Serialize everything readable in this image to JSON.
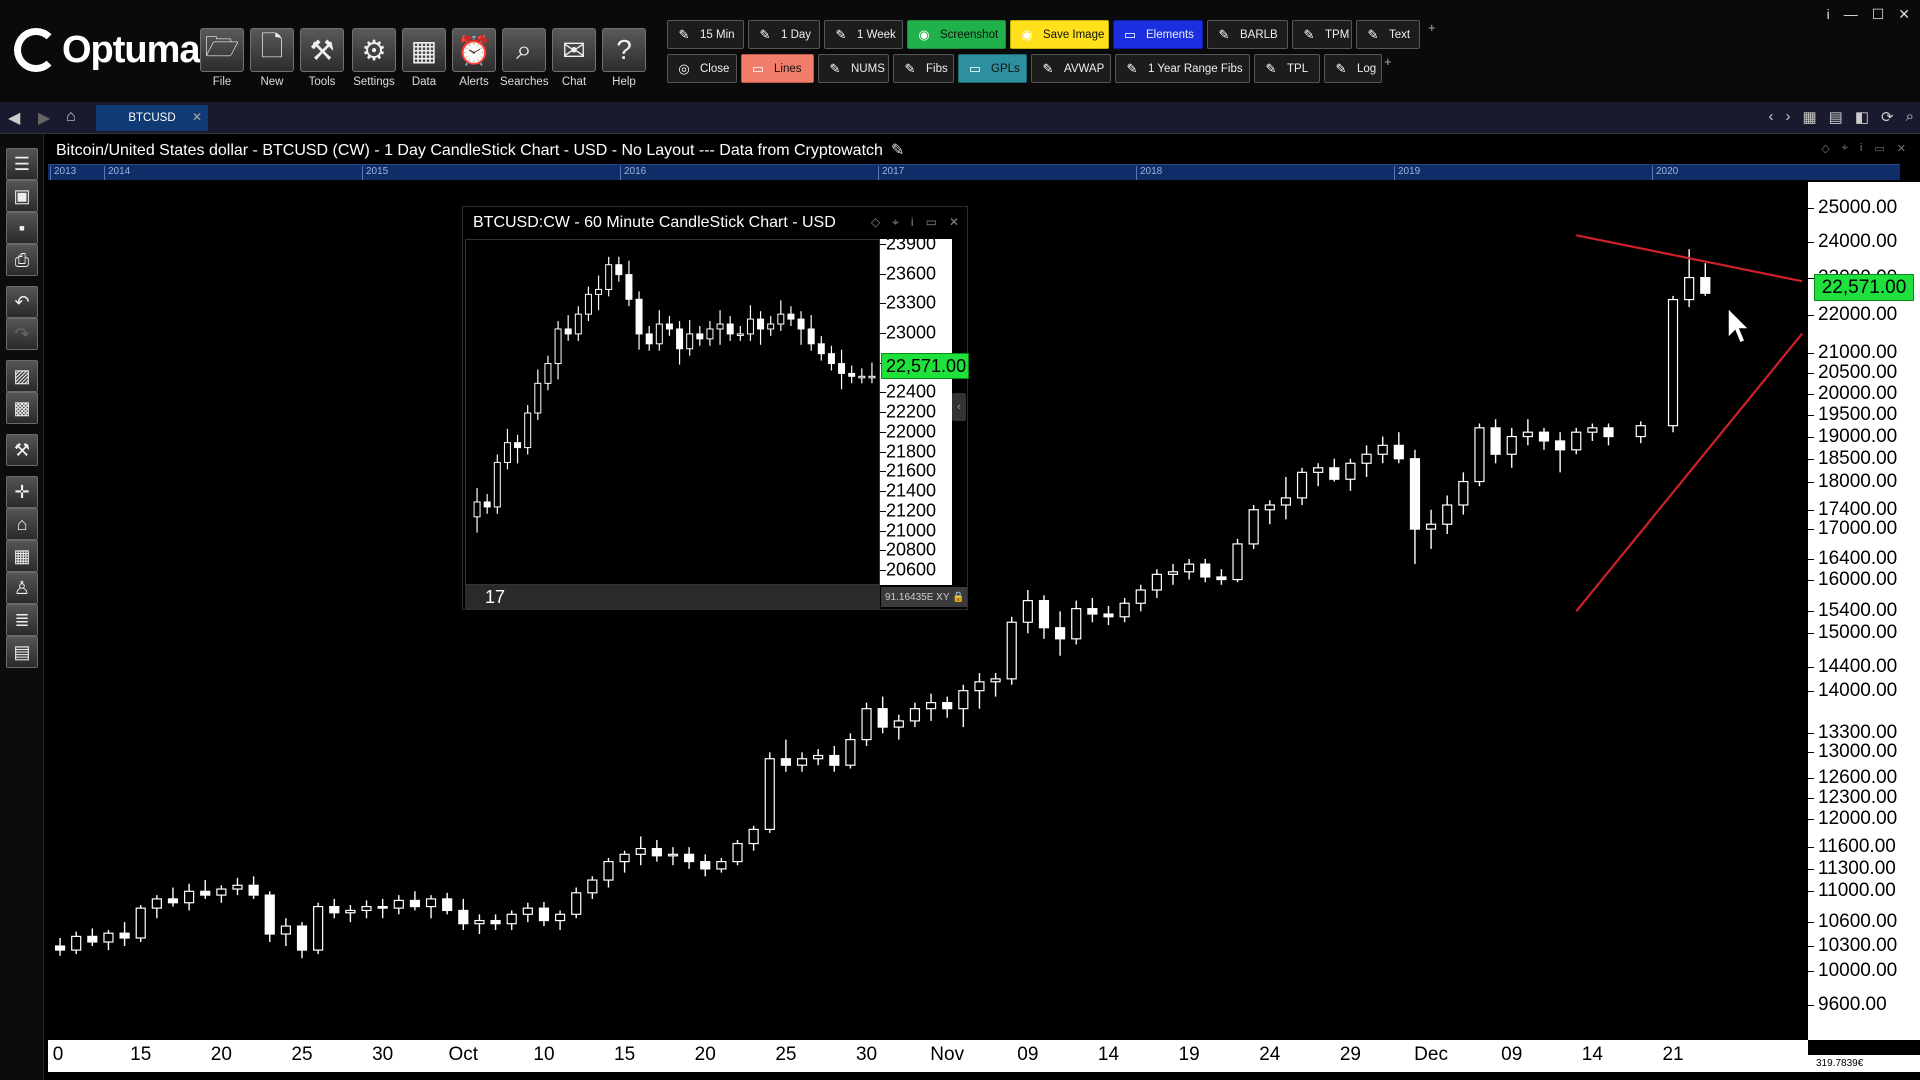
{
  "app": {
    "name": "Optuma",
    "reg": "®"
  },
  "toolbar": {
    "buttons": [
      {
        "label": "File",
        "icon": "folder-icon"
      },
      {
        "label": "New",
        "icon": "new-doc-icon"
      },
      {
        "label": "Tools",
        "icon": "tools-icon"
      },
      {
        "label": "Settings",
        "icon": "gear-icon"
      },
      {
        "label": "Data",
        "icon": "data-icon"
      },
      {
        "label": "Alerts",
        "icon": "alarm-icon"
      },
      {
        "label": "Searches",
        "icon": "search-icon"
      },
      {
        "label": "Chat",
        "icon": "chat-icon"
      },
      {
        "label": "Help",
        "icon": "help-icon"
      }
    ],
    "row1": [
      {
        "label": "15 Min",
        "style": ""
      },
      {
        "label": "1 Day",
        "style": ""
      },
      {
        "label": "1 Week",
        "style": ""
      },
      {
        "label": "Screenshot",
        "style": "green"
      },
      {
        "label": "Save Image",
        "style": "yellow"
      },
      {
        "label": "Elements",
        "style": "blue"
      },
      {
        "label": "BARLB",
        "style": ""
      },
      {
        "label": "TPM",
        "style": ""
      },
      {
        "label": "Text",
        "style": ""
      }
    ],
    "row2": [
      {
        "label": "Close",
        "style": ""
      },
      {
        "label": "Lines",
        "style": "salmon"
      },
      {
        "label": "NUMS",
        "style": ""
      },
      {
        "label": "Fibs",
        "style": ""
      },
      {
        "label": "GPLs",
        "style": "teal"
      },
      {
        "label": "AVWAP",
        "style": ""
      },
      {
        "label": "1 Year Range Fibs",
        "style": ""
      },
      {
        "label": "TPL",
        "style": ""
      },
      {
        "label": "Log",
        "style": ""
      }
    ],
    "plus": "+"
  },
  "window_controls": {
    "info": "i",
    "minimize": "—",
    "maximize": "☐",
    "close": "✕"
  },
  "tabs": {
    "active": "BTCUSD",
    "close": "✕"
  },
  "chart": {
    "title": "Bitcoin/United States dollar - BTCUSD (CW) - 1 Day CandleStick Chart - USD - No Layout --- Data from Cryptowatch",
    "timeline_years": [
      "2013",
      "2014",
      "2015",
      "2016",
      "2017",
      "2018",
      "2019",
      "2020"
    ],
    "current_price": "22,571.00",
    "status_value": "319.7839€",
    "accent_green": "#1fe03c",
    "trendline_color": "#d0202a"
  },
  "chart_data": [
    {
      "type": "candlestick",
      "title": "Bitcoin/United States dollar - BTCUSD (CW) - 1 Day CandleStick Chart - USD - No Layout --- Data from Cryptowatch",
      "yscale": "log",
      "ylim": [
        9200,
        25800
      ],
      "y_ticks": [
        "25000.00",
        "24000.00",
        "23000.00",
        "22000.00",
        "21000.00",
        "20500.00",
        "20000.00",
        "19500.00",
        "19000.00",
        "18500.00",
        "18000.00",
        "17400.00",
        "17000.00",
        "16400.00",
        "16000.00",
        "15400.00",
        "15000.00",
        "14400.00",
        "14000.00",
        "13300.00",
        "13000.00",
        "12600.00",
        "12300.00",
        "12000.00",
        "11600.00",
        "11300.00",
        "11000.00",
        "10600.00",
        "10300.00",
        "10000.00",
        "9600.00"
      ],
      "x_tick_labels": [
        "0",
        "15",
        "20",
        "25",
        "30",
        "Oct",
        "10",
        "15",
        "20",
        "25",
        "30",
        "Nov",
        "09",
        "14",
        "19",
        "24",
        "29",
        "Dec",
        "09",
        "14",
        "21"
      ],
      "x_tick_index": [
        0,
        5,
        10,
        15,
        20,
        25,
        30,
        35,
        40,
        45,
        50,
        55,
        60,
        65,
        70,
        75,
        80,
        85,
        90,
        95,
        100
      ],
      "candles": [
        [
          10300,
          10400,
          10180,
          10250
        ],
        [
          10250,
          10480,
          10200,
          10420
        ],
        [
          10420,
          10520,
          10300,
          10350
        ],
        [
          10350,
          10500,
          10250,
          10460
        ],
        [
          10460,
          10600,
          10300,
          10400
        ],
        [
          10400,
          10820,
          10350,
          10780
        ],
        [
          10780,
          10950,
          10650,
          10900
        ],
        [
          10900,
          11050,
          10800,
          10850
        ],
        [
          10850,
          11100,
          10750,
          11000
        ],
        [
          11000,
          11150,
          10900,
          10950
        ],
        [
          10950,
          11080,
          10850,
          11030
        ],
        [
          11030,
          11180,
          10950,
          11080
        ],
        [
          11080,
          11200,
          10900,
          10950
        ],
        [
          10950,
          11000,
          10350,
          10450
        ],
        [
          10450,
          10650,
          10300,
          10550
        ],
        [
          10550,
          10600,
          10150,
          10250
        ],
        [
          10250,
          10850,
          10200,
          10800
        ],
        [
          10800,
          10900,
          10650,
          10720
        ],
        [
          10720,
          10820,
          10600,
          10750
        ],
        [
          10750,
          10880,
          10650,
          10800
        ],
        [
          10800,
          10900,
          10650,
          10780
        ],
        [
          10780,
          10950,
          10700,
          10880
        ],
        [
          10880,
          11000,
          10750,
          10800
        ],
        [
          10800,
          10950,
          10650,
          10900
        ],
        [
          10900,
          10980,
          10700,
          10750
        ],
        [
          10750,
          10900,
          10500,
          10580
        ],
        [
          10580,
          10700,
          10450,
          10620
        ],
        [
          10620,
          10700,
          10500,
          10580
        ],
        [
          10580,
          10750,
          10500,
          10700
        ],
        [
          10700,
          10850,
          10600,
          10780
        ],
        [
          10780,
          10860,
          10550,
          10620
        ],
        [
          10620,
          10750,
          10500,
          10700
        ],
        [
          10700,
          11050,
          10650,
          10980
        ],
        [
          10980,
          11200,
          10900,
          11150
        ],
        [
          11150,
          11450,
          11050,
          11400
        ],
        [
          11400,
          11550,
          11250,
          11500
        ],
        [
          11500,
          11750,
          11350,
          11580
        ],
        [
          11580,
          11700,
          11400,
          11480
        ],
        [
          11480,
          11600,
          11350,
          11500
        ],
        [
          11500,
          11600,
          11300,
          11400
        ],
        [
          11400,
          11500,
          11200,
          11300
        ],
        [
          11300,
          11450,
          11250,
          11400
        ],
        [
          11400,
          11700,
          11350,
          11650
        ],
        [
          11650,
          11900,
          11550,
          11850
        ],
        [
          11850,
          13000,
          11800,
          12900
        ],
        [
          12900,
          13200,
          12700,
          12800
        ],
        [
          12800,
          13000,
          12700,
          12900
        ],
        [
          12900,
          13050,
          12800,
          12950
        ],
        [
          12950,
          13100,
          12700,
          12800
        ],
        [
          12800,
          13300,
          12750,
          13200
        ],
        [
          13200,
          13800,
          13100,
          13700
        ],
        [
          13700,
          13900,
          13300,
          13400
        ],
        [
          13400,
          13600,
          13200,
          13500
        ],
        [
          13500,
          13800,
          13400,
          13700
        ],
        [
          13700,
          13950,
          13500,
          13800
        ],
        [
          13800,
          13900,
          13550,
          13700
        ],
        [
          13700,
          14100,
          13400,
          14000
        ],
        [
          14000,
          14300,
          13700,
          14150
        ],
        [
          14150,
          14300,
          13900,
          14200
        ],
        [
          14200,
          15300,
          14100,
          15200
        ],
        [
          15200,
          15800,
          15000,
          15600
        ],
        [
          15600,
          15700,
          14900,
          15100
        ],
        [
          15100,
          15400,
          14600,
          14900
        ],
        [
          14900,
          15600,
          14800,
          15450
        ],
        [
          15450,
          15650,
          15200,
          15350
        ],
        [
          15350,
          15500,
          15150,
          15300
        ],
        [
          15300,
          15650,
          15200,
          15550
        ],
        [
          15550,
          15900,
          15400,
          15800
        ],
        [
          15800,
          16200,
          15650,
          16100
        ],
        [
          16100,
          16300,
          15900,
          16150
        ],
        [
          16150,
          16400,
          16000,
          16300
        ],
        [
          16300,
          16400,
          15950,
          16050
        ],
        [
          16050,
          16200,
          15900,
          16000
        ],
        [
          16000,
          16800,
          15950,
          16700
        ],
        [
          16700,
          17500,
          16600,
          17400
        ],
        [
          17400,
          17600,
          17100,
          17500
        ],
        [
          17500,
          18100,
          17200,
          17650
        ],
        [
          17650,
          18300,
          17500,
          18200
        ],
        [
          18200,
          18400,
          17900,
          18300
        ],
        [
          18300,
          18500,
          18000,
          18050
        ],
        [
          18050,
          18500,
          17800,
          18400
        ],
        [
          18400,
          18800,
          18100,
          18600
        ],
        [
          18600,
          19000,
          18400,
          18800
        ],
        [
          18800,
          19100,
          18400,
          18500
        ],
        [
          18500,
          18700,
          16300,
          17000
        ],
        [
          17000,
          17400,
          16600,
          17100
        ],
        [
          17100,
          17700,
          16900,
          17500
        ],
        [
          17500,
          18200,
          17300,
          18000
        ],
        [
          18000,
          19300,
          17900,
          19200
        ],
        [
          19200,
          19400,
          18400,
          18600
        ],
        [
          18600,
          19200,
          18300,
          19000
        ],
        [
          19000,
          19400,
          18800,
          19100
        ],
        [
          19100,
          19200,
          18700,
          18900
        ],
        [
          18900,
          19100,
          18200,
          18700
        ],
        [
          18700,
          19200,
          18600,
          19100
        ],
        [
          19100,
          19300,
          18900,
          19200
        ],
        [
          19200,
          19300,
          18800,
          19000
        ]
      ],
      "trendlines": [
        {
          "from": [
            96,
            15400
          ],
          "to": [
            168,
            21500
          ]
        },
        {
          "from": [
            96,
            24200
          ],
          "to": [
            168,
            22900
          ]
        }
      ]
    },
    {
      "type": "candlestick",
      "title": "BTCUSD:CW - 60 Minute CandleStick Chart - USD",
      "ylim": [
        20450,
        23950
      ],
      "y_ticks": [
        "23900",
        "23600",
        "23300",
        "23000",
        "22700",
        "22400",
        "22200",
        "22000",
        "21800",
        "21600",
        "21400",
        "21200",
        "21000",
        "20800",
        "20600"
      ],
      "x_tick_labels": [
        "17"
      ],
      "current_price": "22,571.00",
      "status_value": "91.16435E",
      "candles_count": 40
    }
  ]
}
